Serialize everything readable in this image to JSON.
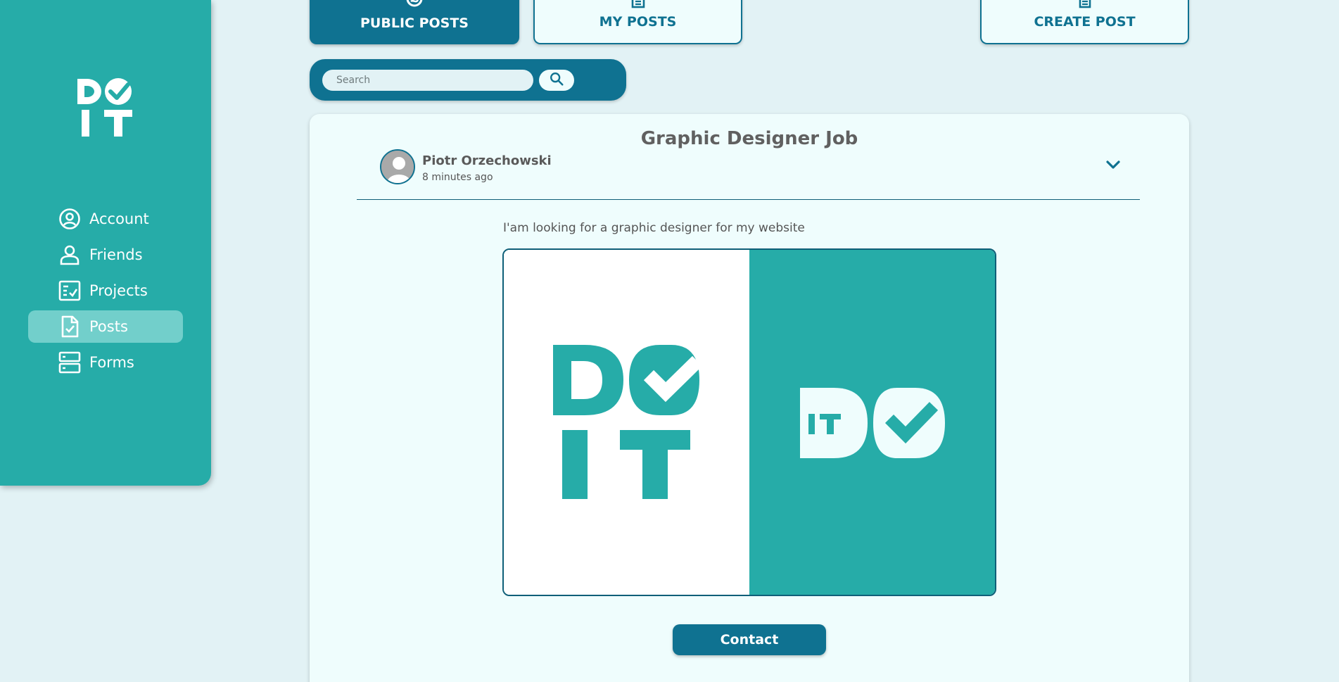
{
  "app": {
    "logo_text": "DO IT"
  },
  "colors": {
    "sidebar": "#26aca8",
    "primary": "#0f7291",
    "background": "#e2f2f5",
    "card": "#effdfd",
    "active_nav": "#72cfcb"
  },
  "sidebar": {
    "items": [
      {
        "label": "Account",
        "icon": "account-circle-icon",
        "active": false
      },
      {
        "label": "Friends",
        "icon": "person-icon",
        "active": false
      },
      {
        "label": "Projects",
        "icon": "checklist-icon",
        "active": false
      },
      {
        "label": "Posts",
        "icon": "document-check-icon",
        "active": true
      },
      {
        "label": "Forms",
        "icon": "server-icon",
        "active": false
      }
    ]
  },
  "tabs": {
    "public": {
      "label": "PUBLIC POSTS",
      "icon": "globe-icon",
      "active": true
    },
    "my": {
      "label": "MY POSTS",
      "icon": "document-icon",
      "active": false
    },
    "create": {
      "label": "CREATE POST",
      "icon": "document-icon",
      "active": false
    }
  },
  "search": {
    "placeholder": "Search",
    "value": "",
    "icon": "search-icon"
  },
  "post": {
    "title": "Graphic Designer Job",
    "author": "Piotr Orzechowski",
    "time": "8 minutes ago",
    "body": "I'am looking for a graphic designer for my website",
    "image_logo_left": "DO IT",
    "image_logo_right": "IT DO",
    "contact_label": "Contact"
  }
}
